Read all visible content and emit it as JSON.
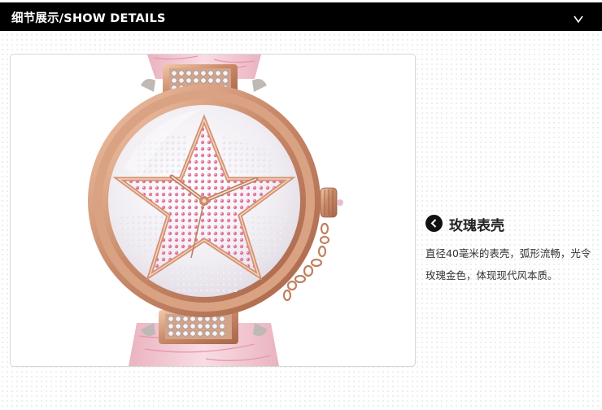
{
  "header": {
    "title": "细节展示/SHOW DETAILS",
    "chevron_icon": "chevron-down-icon"
  },
  "feature": {
    "icon": "chevron-left-circle-icon",
    "title": "玫瑰表壳",
    "description": "直径40毫米的表壳，弧形流畅，光令玫瑰金色，体现现代风本质。"
  },
  "colors": {
    "header_bg": "#000000",
    "rose_gold": "#c98a6a",
    "strap_pink": "#f2c7d0",
    "star_pink": "#d9779a"
  }
}
